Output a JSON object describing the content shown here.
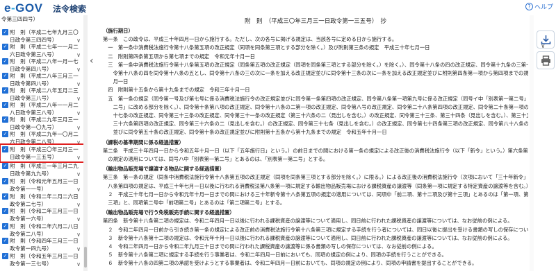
{
  "header": {
    "logo_text": "e-GOV",
    "title": "法令検索",
    "help": "ヘルプ"
  },
  "sidebar": {
    "first_item": "令第三四四号）",
    "items": [
      {
        "label": "附　則（平成二七年九月三〇日政令第三四四号）",
        "selected": false
      },
      {
        "label": "附　則（平成二七年一一月二六日政令第三八号）",
        "selected": false
      },
      {
        "label": "附　則（平成二八年一月一七日政令第四八号）",
        "selected": false
      },
      {
        "label": "附　則（平成二八年三月三一日政令第四八号）",
        "selected": false
      },
      {
        "label": "附　則（平成二八年五月二三日政令第三八号）",
        "selected": false
      },
      {
        "label": "附　則（平成二八年一一月二八日政令第三八号）",
        "selected": false
      },
      {
        "label": "附　則（平成二九年三月三一日政令第一〇九号）",
        "selected": false
      },
      {
        "label": "附　則（平成二九年一〇月二六日政令第二八号）",
        "selected": false
      },
      {
        "label": "附　則（平成三〇年三月三一日政令第一三五号）",
        "selected": true
      },
      {
        "label": "附　則（平成三一年三月二九日政令第九九号）",
        "selected": false
      },
      {
        "label": "附　則（令和元年五月三一日政令第一一号）",
        "selected": false
      },
      {
        "label": "附　則（令和二年二月二六日政令第二七号）",
        "selected": false
      },
      {
        "label": "附　則（令和二年三月三一日政令第一六号）",
        "selected": false
      },
      {
        "label": "附　則（令和二年六月二八日政令第二八号）",
        "selected": false
      },
      {
        "label": "附　則（令和四年三月三一日政令第一四九号）",
        "selected": false
      },
      {
        "label": "附　則（令和五年三月三一日政令第一三七号）",
        "selected": false
      }
    ]
  },
  "document": {
    "title": "附　則　（平成三〇年三月三一日政令第一三五号）　抄",
    "lines": [
      {
        "text": "（施行期日）",
        "bold": true
      },
      {
        "text": "第一条　この政令は、平成三十年四月一日から施行する。ただし、次の各号に掲げる規定は、当該各号に定める日から施行する。",
        "bold": false
      },
      {
        "text": "　一　第一条中消費税法施行令第十八条第五項の改正規定（同項を同条第三項とする部分を除く。）及び附則第三条の規定　平成三十年七月一日",
        "bold": false
      },
      {
        "text": "　二　附則第四条第五項から第七項までの規定　令和元年十月一日",
        "bold": false
      },
      {
        "text": "　三　第一条中消費税法施行令第十八条第五項の改正規定（同条第五項の改正規定（同項を同条第三項とする部分を除く。）を除く。）、同令第十八条の四の改正規定、同令第十九条の三第一項の改正規定、同",
        "bold": false
      },
      {
        "text": "　　令第十八条の四を同令第十八条の五とし、同令第十八条の三の次に一条を加える改正規定並びに同令第十三条の次に一条を加える改正規定並びに附則第四条第一項から第四項までの規定　令和二年四",
        "bold": false
      },
      {
        "text": "　　月一日",
        "bold": false
      },
      {
        "text": "　四　附則第十五条から第十九条までの規定　令和三年十月一日",
        "bold": false
      },
      {
        "text": "　五　第一条の規定（同令第一号及び第七号に係る消費税法施行令の改正規定並びに同令第一条第四項の改正規定、同令第八条第一項第九号に係る改正規定（同号イ中「別表第一第二号」を「別表第一第",
        "bold": false
      },
      {
        "text": "　　二号」に改める部分を除く。）、同令第十条第八項の改正規定、同令第十八条の二第一項の改正規定、同令第八号の改正規定、同令第二十八条第四項の改正規定、同令第二十条第一項の改正規定、同令第二",
        "bold": false
      },
      {
        "text": "　　十七条の改正規定、同令第三十三条の改正規定、同令第三十一条の改正規定（第三十六条の二（見出しを含む。）の改正規定、同令第三十三条、第三十四条（見出しを含む。）、第三十五条、第三十六条及び第",
        "bold": false
      },
      {
        "text": "　　三十六条第四項の改正規定、同令第三十六条の二（見出しを含む。）の改正規定、同令第三十七条（見出しを含む。）の改正規定、同令第七十四条第三項の改正規定、同令第八十八条の改正規定",
        "bold": false
      },
      {
        "text": "　　並びに同令第五十条の改正規定、同令第十条の改正規定並びに附則第十五条から第十九条までの規定　令和五年十月一日",
        "bold": false
      },
      {
        "text": "（課税の基準期間に係る経過措置）",
        "bold": true
      },
      {
        "text": "第二条　平成三十年四月一日から令和五年十月一日（以下「五年施行日」という。）の前日までの間における第一条の規定による改正後の消費税法施行令（以下「新令」という。）第六条第一項第九号ハ",
        "bold": false
      },
      {
        "text": "　の規定の適用については、同号ハ中「別表第一第二号」とあるのは、「別表第一第二号」とする。",
        "bold": false
      },
      {
        "text": "（輸出物品販売場で譲渡する物品に関する経過措置）",
        "bold": true
      },
      {
        "text": "第三条　第一条の規定（同条中消費税法施行令第十八条第五項の改正規定（同項を同条第三項とする部分を除く。）に限る。）による改正後の消費税法施行令（次項において「三十年新令」という。）第十",
        "bold": false
      },
      {
        "text": "　八条第四項の規定は、平成三十年七月一日以後に行われる消費税法第八条第一項に規定する輸出物品販売場における課税資産の譲渡等（同条第一項に規定する特定資産の譲渡等を含む。）について適用する。",
        "bold": false
      },
      {
        "text": "　２　平成三十年七月一日から令和元年十月一日までの間における三十年新令第十八条第五項の規定の適用については、同項中「前二項、第十二項及び第十三項」とあるのは「第一項、第十二項及び第十",
        "bold": false
      },
      {
        "text": "　三項」と、同項第二号中「前項第二号」とあるのは「第二項第二号」とする。",
        "bold": false
      },
      {
        "text": "（輸出物品販売場で行う免税販売手続に関する経過措置）",
        "bold": true
      },
      {
        "text": "第四条　新令第十八条第二項の規定は、令和二年四月一日以後に行われる課税資産の譲渡等について適用し、同日前に行われた課税資産の譲渡等については、なお従前の例による。",
        "bold": false
      },
      {
        "text": "　２　令和二年四月一日前から引き続き第一条の規定による改正前の消費税法施行令第十八条第三項に規定する手続を行う者については、同日以後に提出を受ける書類の写しの保存について、なお従前の例による。",
        "bold": false
      },
      {
        "text": "　３　新令第十八条第十二項の規定は、令和元年十月一日以後に行われる課税資産の譲渡等について適用し、同日前に行われた課税資産の譲渡等については、なお従前の例による。",
        "bold": false
      },
      {
        "text": "　４　令和二年四月一日から令和二年九月三十日までの間に行われた課税資産の譲渡等に係る書類の写しの保存については、なお従前の例による。",
        "bold": false
      },
      {
        "text": "　５　新令第十八条第二項に規定する手続を行う事業者は、令和二年四月一日前においても、同項の規定の例により、同項の手続を行うことができる。",
        "bold": false
      },
      {
        "text": "　６　新令第十八条の四第二項の承認を受けようとする事業者は、令和二年四月一日前においても、同項の規定の例により、同項の申請書を提出することができる。",
        "bold": false
      }
    ]
  },
  "tools": {
    "download_icon": "download-icon",
    "print_icon": "print-icon"
  }
}
